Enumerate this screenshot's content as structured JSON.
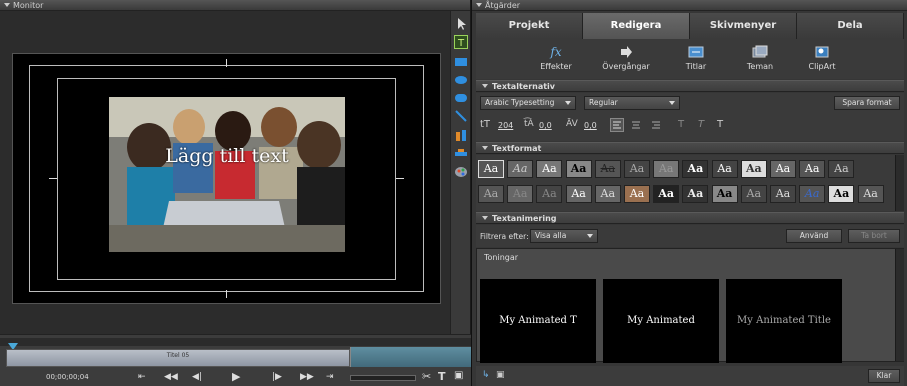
{
  "monitor": {
    "title": "Monitor",
    "overlay_text": "Lägg till text",
    "clip_label": "Titel 05",
    "timecode": "00;00;00;04",
    "tools": [
      "select-arrow-icon",
      "text-tool-icon",
      "rectangle-icon",
      "rounded-rect-icon",
      "ellipse-icon",
      "line-icon",
      "align-icon",
      "arrange-icon",
      "palette-icon"
    ]
  },
  "actions": {
    "title": "Åtgärder",
    "tabs": [
      "Projekt",
      "Redigera",
      "Skivmenyer",
      "Dela"
    ],
    "active_tab": "Redigera",
    "subtabs": [
      "Effekter",
      "Övergångar",
      "Titlar",
      "Teman",
      "ClipArt"
    ],
    "text_options": {
      "header": "Textalternativ",
      "font": "Arabic Typesetting",
      "style": "Regular",
      "save_button": "Spara format",
      "size": "204",
      "leading": "0,0",
      "kerning": "0,0"
    },
    "text_format": {
      "header": "Textformat"
    },
    "text_animation": {
      "header": "Textanimering",
      "filter_label": "Filtrera efter:",
      "filter_value": "Visa alla",
      "apply_button": "Använd",
      "remove_button": "Ta bort",
      "category": "Toningar",
      "thumbnails": [
        "My Animated T",
        "My Animated",
        "My Animated Title"
      ]
    },
    "done_button": "Klar"
  },
  "colors": {
    "accent": "#5f8ea0",
    "panel": "#363636"
  }
}
